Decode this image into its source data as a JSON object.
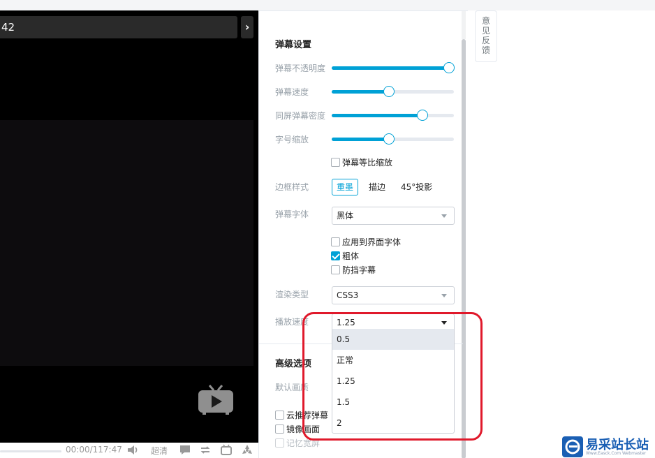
{
  "player": {
    "title_fragment": "42",
    "next_glyph": "›",
    "time_current": "00:00",
    "time_separator": "/",
    "time_total": "117:47",
    "quality": "超清"
  },
  "panel": {
    "danmaku_title": "弹幕设置",
    "sliders": [
      {
        "label": "弹幕不透明度",
        "level_percent": 96
      },
      {
        "label": "弹幕速度",
        "level_percent": 47
      },
      {
        "label": "同屏弹幕密度",
        "level_percent": 74
      },
      {
        "label": "字号缩放",
        "level_percent": 47
      }
    ],
    "proportional_scale": {
      "label": "弹幕等比缩放",
      "checked": false
    },
    "border_style": {
      "label": "边框样式",
      "options": [
        "重墨",
        "描边",
        "45°投影"
      ],
      "selected": "重墨"
    },
    "font": {
      "label": "弹幕字体",
      "value": "黑体"
    },
    "font_checks": [
      {
        "label": "应用到界面字体",
        "checked": false
      },
      {
        "label": "粗体",
        "checked": true
      },
      {
        "label": "防挡字幕",
        "checked": false
      }
    ],
    "render": {
      "label": "渲染类型",
      "value": "CSS3"
    },
    "speed": {
      "label": "播放速度",
      "value": "1.25",
      "options": [
        "0.5",
        "正常",
        "1.25",
        "1.5",
        "2"
      ],
      "highlighted": "0.5"
    },
    "advanced_title": "高级选项",
    "default_quality_label": "默认画质",
    "advanced_checks": [
      {
        "label": "云推荐弹幕",
        "checked": false
      },
      {
        "label": "镜像画面",
        "checked": false
      },
      {
        "label": "记忆宽屏",
        "checked": false
      }
    ]
  },
  "feedback": {
    "chars": [
      "意",
      "见",
      "反",
      "馈"
    ]
  },
  "watermark": {
    "title": "易采站长站",
    "sub": "Www.Easck.Com  Webmaster"
  },
  "colors": {
    "accent": "#00a1d6",
    "annotation": "#e0192b",
    "watermark": "#1a5fb4"
  }
}
